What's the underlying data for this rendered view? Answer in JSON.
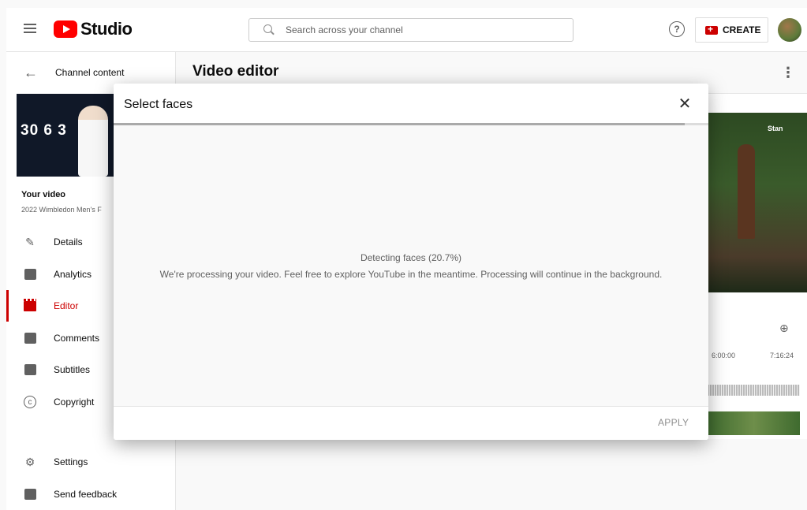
{
  "topbar": {
    "logo_text": "Studio",
    "search_placeholder": "Search across your channel",
    "help_glyph": "?",
    "create_label": "CREATE"
  },
  "sidebar": {
    "back_label": "Channel content",
    "thumbnail_score": "30 6 3",
    "your_video_label": "Your video",
    "video_title": "2022 Wimbledon Men's F",
    "items": [
      {
        "label": "Details",
        "icon": "pencil-icon"
      },
      {
        "label": "Analytics",
        "icon": "analytics-icon"
      },
      {
        "label": "Editor",
        "icon": "clapper-icon",
        "active": true
      },
      {
        "label": "Comments",
        "icon": "comments-icon"
      },
      {
        "label": "Subtitles",
        "icon": "subtitles-icon"
      },
      {
        "label": "Copyright",
        "icon": "copyright-icon"
      },
      {
        "label": "Settings",
        "icon": "gear-icon"
      },
      {
        "label": "Send feedback",
        "icon": "feedback-icon"
      }
    ]
  },
  "main": {
    "title": "Video editor",
    "preview_watermark": "Stan",
    "timeline": {
      "time_a": "6:00:00",
      "time_b": "7:16:24"
    }
  },
  "dialog": {
    "title": "Select faces",
    "progress_fraction": 0.96,
    "status_title": "Detecting faces (20.7%)",
    "status_message": "We're processing your video. Feel free to explore YouTube in the meantime. Processing will continue in the background.",
    "apply_label": "APPLY"
  },
  "colors": {
    "brand_red": "#ff0000",
    "active_red": "#cc0000",
    "muted_text": "#606060"
  }
}
